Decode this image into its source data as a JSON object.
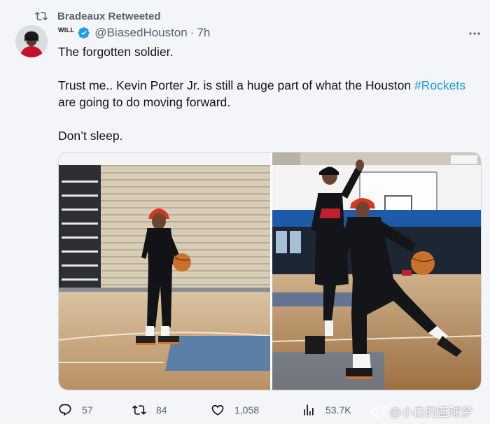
{
  "retweet": {
    "text": "Bradeaux Retweeted",
    "icon": "retweet-icon"
  },
  "author": {
    "display_name": "WILL",
    "handle": "@BiasedHouston",
    "time": "7h",
    "separator": "·",
    "verified_color": "#1d9bf0"
  },
  "tweet": {
    "line1": "The forgotten soldier.",
    "line2_a": "Trust me.. Kevin Porter Jr. is still a huge part of what the Houston ",
    "hashtag": "#Rockets",
    "line2_b": "are going to do moving forward.",
    "line3": "Don’t sleep."
  },
  "actions": {
    "reply_count": "57",
    "retweet_count": "84",
    "like_count": "1,058",
    "views_count": "53.7K"
  },
  "watermark": {
    "text": "@小白的篮球梦"
  },
  "colors": {
    "accent": "#1d9bf0",
    "muted": "#536471",
    "text": "#0f1419"
  }
}
